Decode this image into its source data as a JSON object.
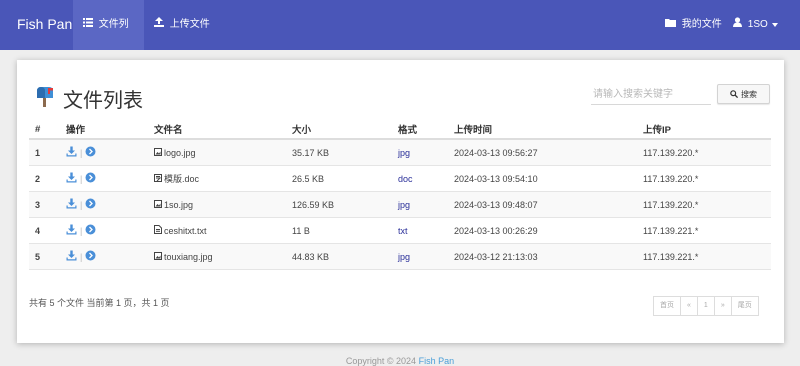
{
  "navbar": {
    "brand": "Fish Pan",
    "file_list": "文件列表",
    "upload": "上传文件",
    "my_files": "我的文件",
    "user": "1SO"
  },
  "page": {
    "title": "文件列表",
    "search_placeholder": "请输入搜索关键字",
    "search_button": "搜索"
  },
  "table": {
    "headers": [
      "#",
      "操作",
      "文件名",
      "大小",
      "格式",
      "上传时间",
      "上传IP"
    ],
    "rows": [
      {
        "num": "1",
        "name": "logo.jpg",
        "file_icon": "image-icon",
        "size": "35.17 KB",
        "format": "jpg",
        "time": "2024-03-13 09:56:27",
        "ip": "117.139.220.*"
      },
      {
        "num": "2",
        "name": "模版.doc",
        "file_icon": "document-icon",
        "size": "26.5 KB",
        "format": "doc",
        "time": "2024-03-13 09:54:10",
        "ip": "117.139.220.*"
      },
      {
        "num": "3",
        "name": "1so.jpg",
        "file_icon": "image-icon",
        "size": "126.59 KB",
        "format": "jpg",
        "time": "2024-03-13 09:48:07",
        "ip": "117.139.220.*"
      },
      {
        "num": "4",
        "name": "ceshitxt.txt",
        "file_icon": "text-file-icon",
        "size": "11 B",
        "format": "txt",
        "time": "2024-03-13 00:26:29",
        "ip": "117.139.221.*"
      },
      {
        "num": "5",
        "name": "touxiang.jpg",
        "file_icon": "image-icon",
        "size": "44.83 KB",
        "format": "jpg",
        "time": "2024-03-12 21:13:03",
        "ip": "117.139.221.*"
      }
    ]
  },
  "summary": "共有 5 个文件  当前第 1 页，共 1 页",
  "pagination": {
    "first": "首页",
    "prev": "«",
    "current": "1",
    "next": "»",
    "last": "尾页"
  },
  "footer": {
    "prefix": "Copyright © 2024 ",
    "link": "Fish Pan"
  },
  "colors": {
    "navbar": "#4a56b8",
    "download_icon": "#4a8fd8",
    "detail_icon": "#4a8fd8",
    "format_link": "#2a2f99"
  }
}
